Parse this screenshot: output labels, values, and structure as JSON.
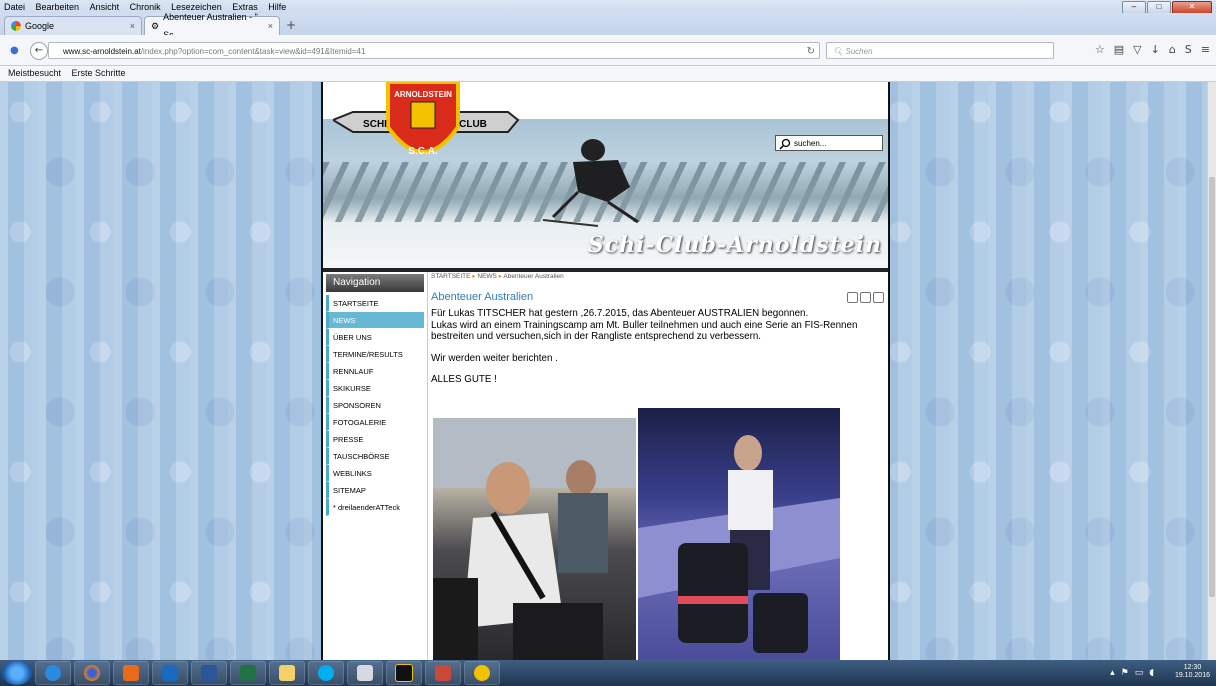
{
  "menubar": {
    "items": [
      "Datei",
      "Bearbeiten",
      "Ansicht",
      "Chronik",
      "Lesezeichen",
      "Extras",
      "Hilfe"
    ]
  },
  "tabs": [
    {
      "label": "Google",
      "icon": "google-icon"
    },
    {
      "label": "Abenteuer Australien - \" Sc...",
      "icon": "sca-icon"
    }
  ],
  "address": {
    "host": "www.sc-arnoldstein.at",
    "path": "/index.php?option=com_content&task=view&id=491&Itemid=41"
  },
  "search": {
    "placeholder": "Suchen"
  },
  "bookmarks": [
    "Meistbesucht",
    "Erste Schritte"
  ],
  "site": {
    "logo_text_top": "ARNOLDSTEIN",
    "logo_left": "SCHI",
    "logo_right": "CLUB",
    "logo_bottom": "S.C.A.",
    "title": "Schi-Club-Arnoldstein",
    "search_placeholder": "suchen..."
  },
  "navigation": {
    "heading": "Navigation",
    "items": [
      "STARTSEITE",
      "NEWS",
      "ÜBER UNS",
      "TERMINE/RESULTS",
      "RENNLAUF",
      "SKIKURSE",
      "SPONSOREN",
      "FOTOGALERIE",
      "PRESSE",
      "TAUSCHBÖRSE",
      "WEBLINKS",
      "SITEMAP",
      "* dreilaenderATTeck"
    ],
    "active_index": 1
  },
  "breadcrumb": [
    "STARTSEITE",
    "NEWS",
    "Abenteuer Australien"
  ],
  "article": {
    "title": "Abenteuer Australien",
    "p1": "Für Lukas TITSCHER  hat gestern ,26.7.2015, das Abenteuer AUSTRALIEN begonnen.",
    "p1b": "Lukas wird an einem Trainingscamp am Mt. Buller teilnehmen und auch eine Serie an FIS-Rennen bestreiten und versuchen,sich in der Rangliste entsprechend zu verbessern.",
    "p2": "Wir werden weiter berichten .",
    "p3": "ALLES GUTE !"
  },
  "taskbar": {
    "time": "12:30",
    "date": "19.10.2016"
  },
  "colors": {
    "accent": "#2c7fb8",
    "nav_active": "#67b8d3",
    "nav_border": "#4aa8c8"
  }
}
